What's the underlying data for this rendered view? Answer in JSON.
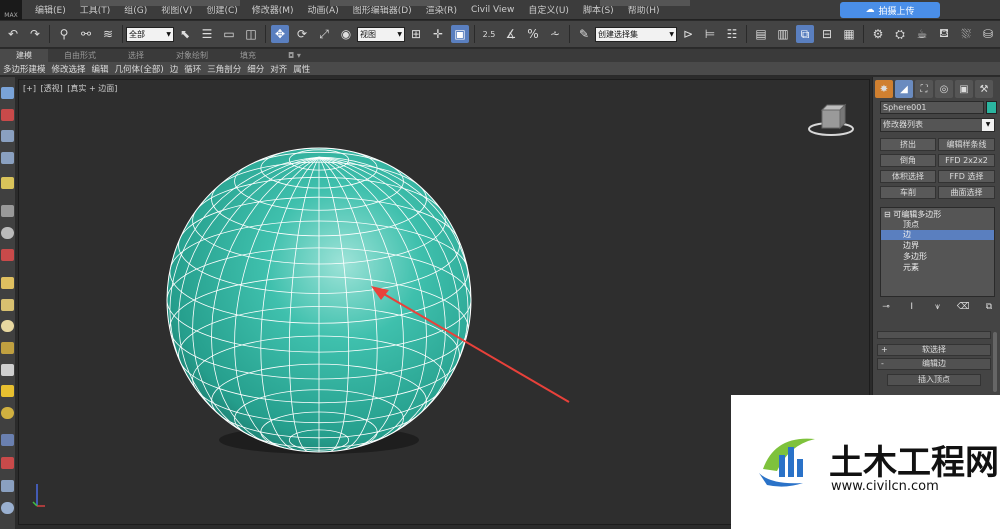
{
  "menubar": {
    "items": [
      "编辑(E)",
      "工具(T)",
      "组(G)",
      "视图(V)",
      "创建(C)",
      "修改器(M)",
      "动画(A)",
      "图形编辑器(D)",
      "渲染(R)",
      "Civil View",
      "自定义(U)",
      "脚本(S)",
      "帮助(H)"
    ],
    "cloud_button": "拍摄上传",
    "logo": "MAX"
  },
  "toolbar": {
    "selection_filter": "全部",
    "ref_coord": "视图",
    "named_selection": "创建选择集",
    "angle_snap": "2.5",
    "percent_snap": "%"
  },
  "ribbon": {
    "tabs": [
      "建模",
      "自由形式",
      "选择",
      "对象绘制",
      "填充"
    ],
    "active_tab": "建模",
    "subtabs": [
      "多边形建模",
      "修改选择",
      "编辑",
      "几何体(全部)",
      "边",
      "循环",
      "三角剖分",
      "细分",
      "对齐",
      "属性"
    ]
  },
  "viewport": {
    "label_plus": "[+]",
    "label_view": "[透视]",
    "label_shading": "[真实 + 边面]",
    "sphere_color": "#2bb5a0",
    "arrow_color": "#e8413a"
  },
  "command_panel": {
    "object_name": "Sphere001",
    "object_color": "#2bb5a0",
    "modifier_list": "修改器列表",
    "buttons": [
      "挤出",
      "编辑样条线",
      "倒角",
      "FFD 2x2x2",
      "体积选择",
      "FFD 选择",
      "车削",
      "曲面选择"
    ],
    "stack": {
      "root": "可编辑多边形",
      "items": [
        "顶点",
        "边",
        "边界",
        "多边形",
        "元素"
      ],
      "selected": "边"
    },
    "rollouts": {
      "soft_selection": "软选择",
      "edit_edges": "编辑边",
      "insert_vertex": "插入顶点"
    }
  },
  "watermark": {
    "title": "土木工程网",
    "url": "www.civilcn.com"
  }
}
